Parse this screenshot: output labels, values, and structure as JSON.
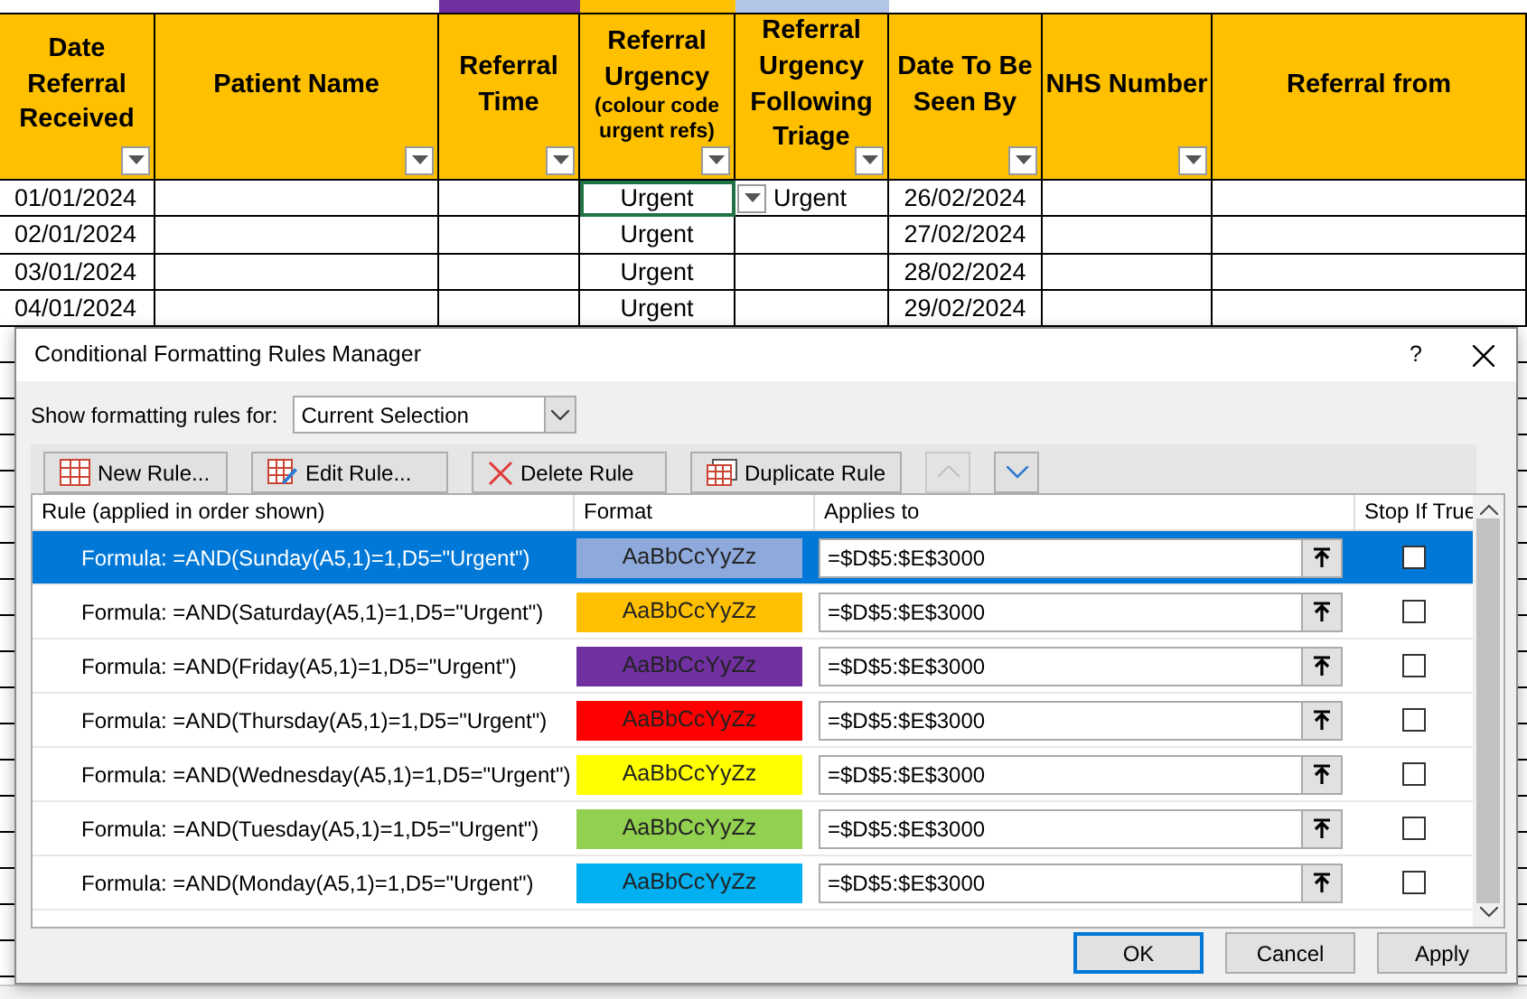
{
  "sheet": {
    "strip": [
      {
        "color": "#7030a0"
      },
      {
        "color": "#ffc000"
      },
      {
        "color": "#b4c6e7"
      }
    ],
    "columns": [
      {
        "header": "Date Referral Received",
        "filter": true
      },
      {
        "header": "Patient Name",
        "filter": true
      },
      {
        "header": "Referral Time",
        "filter": true
      },
      {
        "header": "Referral Urgency",
        "note": "(colour code urgent refs)",
        "filter": true
      },
      {
        "header": "Referral Urgency Following Triage",
        "filter": true
      },
      {
        "header": "Date To Be Seen By",
        "filter": true
      },
      {
        "header": "NHS Number",
        "filter": true
      },
      {
        "header": "Referral from",
        "filter": false
      }
    ],
    "rows": [
      {
        "received": "01/01/2024",
        "urgency": "Urgent",
        "triage": "Urgent",
        "seen_by": "26/02/2024",
        "selected": true
      },
      {
        "received": "02/01/2024",
        "urgency": "Urgent",
        "seen_by": "27/02/2024",
        "selected": false
      },
      {
        "received": "03/01/2024",
        "urgency": "Urgent",
        "seen_by": "28/02/2024",
        "selected": false
      },
      {
        "received": "04/01/2024",
        "urgency": "Urgent",
        "seen_by": "29/02/2024",
        "selected": false
      }
    ]
  },
  "dialog": {
    "title": "Conditional Formatting Rules Manager",
    "help": "?",
    "scope_label": "Show formatting rules for:",
    "scope_value": "Current Selection",
    "toolbar": [
      {
        "kind": "new",
        "label": "New Rule..."
      },
      {
        "kind": "edit",
        "label": "Edit Rule..."
      },
      {
        "kind": "delete",
        "label": "Delete Rule"
      },
      {
        "kind": "duplicate",
        "label": "Duplicate Rule"
      },
      {
        "kind": "up",
        "disabled": true
      },
      {
        "kind": "down",
        "disabled": false
      }
    ],
    "columns": [
      "Rule (applied in order shown)",
      "Format",
      "Applies to",
      "Stop If True"
    ],
    "rules": [
      {
        "formula": "Formula: =AND(Sunday(A5,1)=1,D5=\"Urgent\")",
        "sample": "AaBbCcYyZz",
        "color": "#8ea9db",
        "applies_to": "=$D$5:$E$3000",
        "stop_if_true": false,
        "selected": true
      },
      {
        "formula": "Formula: =AND(Saturday(A5,1)=1,D5=\"Urgent\")",
        "sample": "AaBbCcYyZz",
        "color": "#ffc000",
        "applies_to": "=$D$5:$E$3000",
        "stop_if_true": false,
        "selected": false
      },
      {
        "formula": "Formula: =AND(Friday(A5,1)=1,D5=\"Urgent\")",
        "sample": "AaBbCcYyZz",
        "color": "#7030a0",
        "applies_to": "=$D$5:$E$3000",
        "stop_if_true": false,
        "selected": false
      },
      {
        "formula": "Formula: =AND(Thursday(A5,1)=1,D5=\"Urgent\")",
        "sample": "AaBbCcYyZz",
        "color": "#ff0000",
        "applies_to": "=$D$5:$E$3000",
        "stop_if_true": false,
        "selected": false
      },
      {
        "formula": "Formula: =AND(Wednesday(A5,1)=1,D5=\"Urgent\")",
        "sample": "AaBbCcYyZz",
        "color": "#ffff00",
        "applies_to": "=$D$5:$E$3000",
        "stop_if_true": false,
        "selected": false
      },
      {
        "formula": "Formula: =AND(Tuesday(A5,1)=1,D5=\"Urgent\")",
        "sample": "AaBbCcYyZz",
        "color": "#92d050",
        "applies_to": "=$D$5:$E$3000",
        "stop_if_true": false,
        "selected": false
      },
      {
        "formula": "Formula: =AND(Monday(A5,1)=1,D5=\"Urgent\")",
        "sample": "AaBbCcYyZz",
        "color": "#00b0f0",
        "applies_to": "=$D$5:$E$3000",
        "stop_if_true": false,
        "selected": false
      }
    ],
    "buttons": [
      {
        "label": "OK",
        "default": true
      },
      {
        "label": "Cancel",
        "default": false
      },
      {
        "label": "Apply",
        "default": false
      }
    ]
  }
}
